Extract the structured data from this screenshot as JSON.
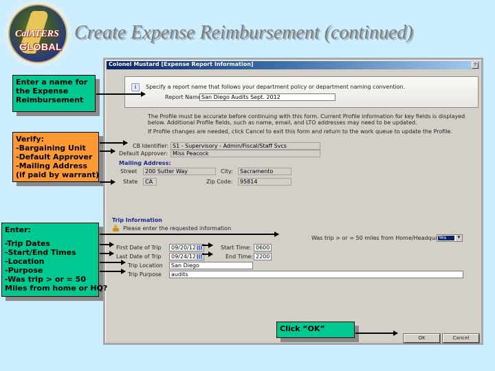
{
  "logo": {
    "line1": "CalATERS",
    "line2": "GLOBAL"
  },
  "page_title": "Create Expense Reimbursement (continued)",
  "dialog": {
    "title": "Colonel Mustard [Expense Report Information]",
    "help_glyph": "?",
    "info_message": "Specify a report name that follows your department policy or department naming convention.",
    "report_name_label": "Report Name:",
    "report_name_value": "San Diego Audits Sept. 2012",
    "profile_note_line1": "The Profile must be accurate before continuing with this form. Current Profile information for key fields is displayed",
    "profile_note_line2": "below. Additional Profile fields, such as name, email, and LTO addresses may need to be updated.",
    "profile_note_line3": "If Profile changes are needed, click Cancel to exit this form and return to the work queue to update the Profile.",
    "cb_identifier_label": "CB Identifier:",
    "cb_identifier_value": "S1 - Supervisory - Admin/Fiscal/Staff Svcs",
    "default_approver_label": "Default Approver:",
    "default_approver_value": "Miss Peacock",
    "mailing_address_heading": "Mailing Address:",
    "street_label": "Street",
    "street_value": "200 Sutter Way",
    "city_label": "City:",
    "city_value": "Sacramento",
    "state_label": "State",
    "state_value": "CA",
    "zip_label": "Zip Code:",
    "zip_value": "95814",
    "trip_info_heading": "Trip Information",
    "trip_info_message": "Please enter the requested information",
    "first_date_label": "First Date of Trip",
    "first_date_value": "09/20/12",
    "last_date_label": "Last Date of Trip",
    "last_date_value": "09/24/12",
    "start_time_label": "Start Time:",
    "start_time_value": "0600",
    "end_time_label": "End Time:",
    "end_time_value": "2200",
    "trip_location_label": "Trip Location",
    "trip_location_value": "San Diego",
    "trip_purpose_label": "Trip Purpose",
    "trip_purpose_value": "audits",
    "fifty_miles_label": "Was trip > or = 50 miles from Home/Headquarters?",
    "fifty_miles_value": "Yes",
    "ok_label": "OK",
    "cancel_label": "Cancel"
  },
  "callouts": {
    "report_name": [
      "Enter a name for",
      "the Expense",
      "Reimbursement"
    ],
    "verify": [
      "Verify:",
      "-Bargaining Unit",
      "-Default Approver",
      "-Mailing Address",
      "(if paid by warrant)"
    ],
    "enter": [
      "Enter:",
      "",
      "-Trip Dates",
      "-Start/End Times",
      "-Location",
      "-Purpose",
      "-Was trip > or = 50",
      "Miles from home or HQ?"
    ],
    "click_ok": [
      "Click “OK”"
    ]
  },
  "colors": {
    "callout_green": "#00c891",
    "callout_orange": "#ff9933",
    "background": "#cceeff",
    "title_gray": "#7c7c7c"
  }
}
